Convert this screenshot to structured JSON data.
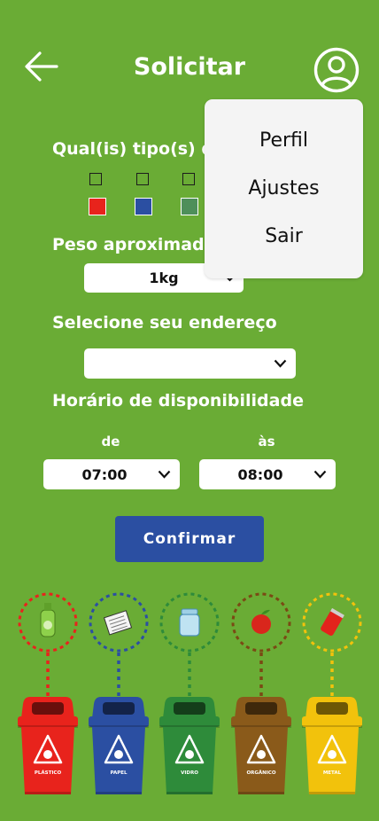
{
  "header": {
    "title": "Solicitar",
    "back_icon": "arrow-left-icon",
    "profile_icon": "user-circle-icon"
  },
  "form": {
    "types_label": "Qual(is) tipo(s) de",
    "type_swatches": [
      "#e8231c",
      "#2b4fa2",
      "#4e8f5a"
    ],
    "weight_label": "Peso aproximado",
    "weight_value": "1kg",
    "address_label": "Selecione seu endereço",
    "address_value": "",
    "availability_label": "Horário de disponibilidade",
    "from_label": "de",
    "to_label": "às",
    "from_value": "07:00",
    "to_value": "08:00"
  },
  "confirm_label": "Confirmar",
  "menu": {
    "items": [
      "Perfil",
      "Ajustes",
      "Sair"
    ]
  },
  "bins": [
    {
      "label": "PLÁSTICO",
      "color": "#e8231c",
      "dots": "#e8231c",
      "icon": "bottle-icon"
    },
    {
      "label": "PAPEL",
      "color": "#2b4fa2",
      "dots": "#2b4fa2",
      "icon": "newspaper-icon"
    },
    {
      "label": "VIDRO",
      "color": "#2e8b3a",
      "dots": "#2e8b3a",
      "icon": "jar-icon"
    },
    {
      "label": "ORGÂNICO",
      "color": "#8a5a1a",
      "dots": "#7a4a14",
      "icon": "apple-icon"
    },
    {
      "label": "METAL",
      "color": "#f2c20c",
      "dots": "#f2c20c",
      "icon": "can-icon"
    }
  ]
}
